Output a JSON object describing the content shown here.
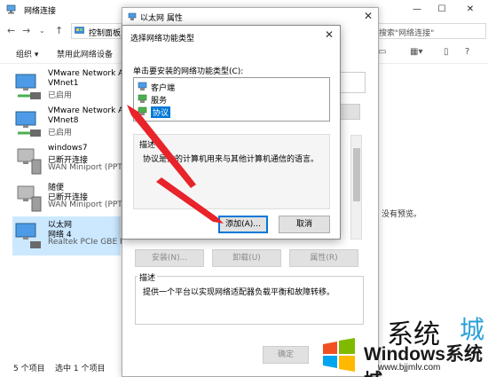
{
  "explorer": {
    "title": "网络连接",
    "address": "控制面板",
    "search_placeholder": "搜索\"网络连接\"",
    "toolbar": {
      "organize": "组织 ▾",
      "disable": "禁用此网络设备"
    },
    "adapters": [
      {
        "name": "VMware Network Ad",
        "sub": "VMnet1",
        "status": "已启用"
      },
      {
        "name": "VMware Network Ad",
        "sub": "VMnet8",
        "status": "已启用"
      },
      {
        "name": "windows7",
        "sub": "已断开连接",
        "status": "WAN Miniport (PPTP"
      },
      {
        "name": "随便",
        "sub": "已断开连接",
        "status": "WAN Miniport (PPTP"
      },
      {
        "name": "以太网",
        "sub": "网络 4",
        "status": "Realtek PCIe GBE Far"
      }
    ],
    "status_count": "5 个项目",
    "status_selected": "选中 1 个项目",
    "no_preview": "没有预览。"
  },
  "props": {
    "title": "以太网 属性",
    "install": "安装(N)...",
    "uninstall": "卸载(U)",
    "properties": "属性(R)",
    "desc_label": "描述",
    "desc_text": "提供一个平台以实现网络适配器负载平衡和故障转移。",
    "ok": "确定"
  },
  "dialog": {
    "title": "选择网络功能类型",
    "prompt": "单击要安装的网络功能类型(C):",
    "items": [
      "客户端",
      "服务",
      "协议"
    ],
    "desc_label": "描述",
    "desc_text": "协议是你的计算机用来与其他计算机通信的语言。",
    "add": "添加(A)...",
    "cancel": "取消"
  },
  "watermark": {
    "brand": "Windows系统城",
    "url": "www.bjjmlv.com",
    "bg_text": "系统",
    "bg_text2": "城"
  },
  "colors": {
    "accent": "#0078d7",
    "annotation": "#e8232a",
    "selection": "#cce8ff"
  }
}
